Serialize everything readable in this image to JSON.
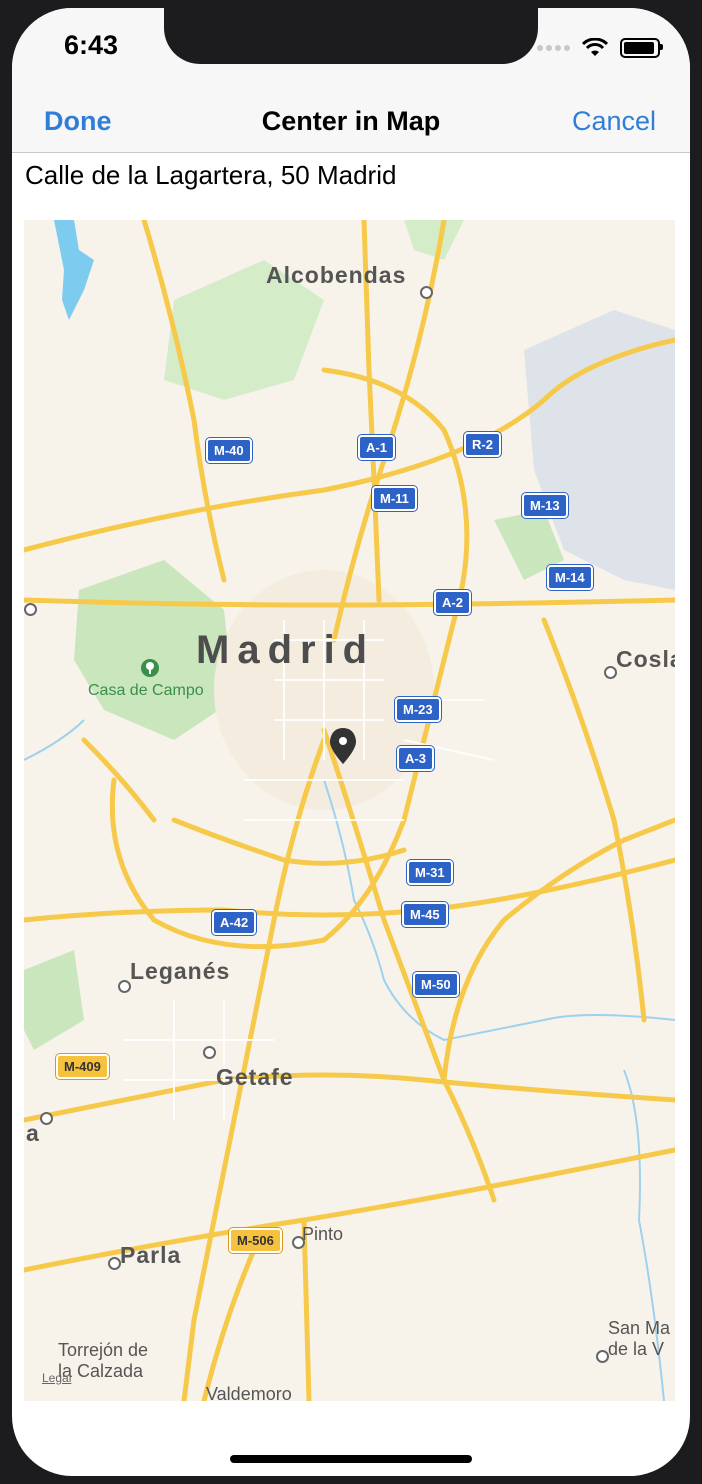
{
  "status": {
    "time": "6:43"
  },
  "nav": {
    "done_label": "Done",
    "title": "Center in Map",
    "cancel_label": "Cancel"
  },
  "address": "Calle de la Lagartera, 50 Madrid",
  "map": {
    "legal": "Legal",
    "places": {
      "madrid": "Madrid",
      "alcobendas": "Alcobendas",
      "casa_de_campo": "Casa de Campo",
      "coslada": "Cosla",
      "leganes": "Leganés",
      "getafe": "Getafe",
      "pinto": "Pinto",
      "parla": "Parla",
      "torrejon_line1": "Torrejón de",
      "torrejon_line2": "la Calzada",
      "valdemoro": "Valdemoro",
      "san_martin_line1": "San Ma",
      "san_martin_line2": "de la V",
      "fragment_a": "a"
    },
    "roads": {
      "m40": "M-40",
      "a1": "A-1",
      "r2": "R-2",
      "m11": "M-11",
      "m13": "M-13",
      "m14": "M-14",
      "a2": "A-2",
      "m23": "M-23",
      "a3": "A-3",
      "m31": "M-31",
      "a42": "A-42",
      "m45": "M-45",
      "m50": "M-50",
      "m409": "M-409",
      "m506": "M-506"
    }
  }
}
